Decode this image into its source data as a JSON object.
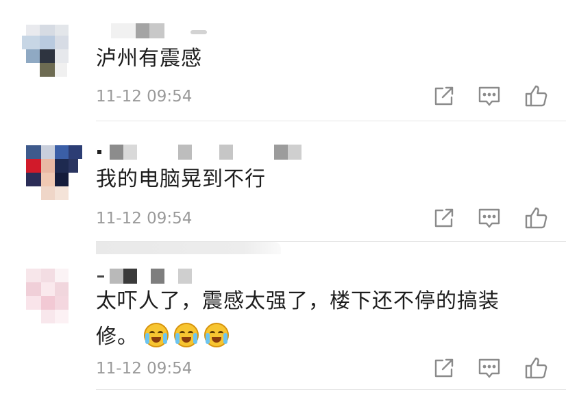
{
  "comments": [
    {
      "text": "泸州有震感",
      "time": "11-12 09:54"
    },
    {
      "text": "我的电脑晃到不行",
      "time": "11-12 09:54"
    },
    {
      "text_line1": "太吓人了，震感太强了，楼下还不停的搞装",
      "text_line2": "修。",
      "emojis": [
        "crying-laughing-emoji",
        "crying-laughing-emoji",
        "crying-laughing-emoji"
      ],
      "time": "11-12 09:54"
    }
  ],
  "actions": [
    "share-icon",
    "reply-icon",
    "like-icon"
  ],
  "colors": {
    "text": "#1d1d1d",
    "meta": "#9a9a9a",
    "icon": "#8a8a8a",
    "divider": "#e6e6e6"
  }
}
